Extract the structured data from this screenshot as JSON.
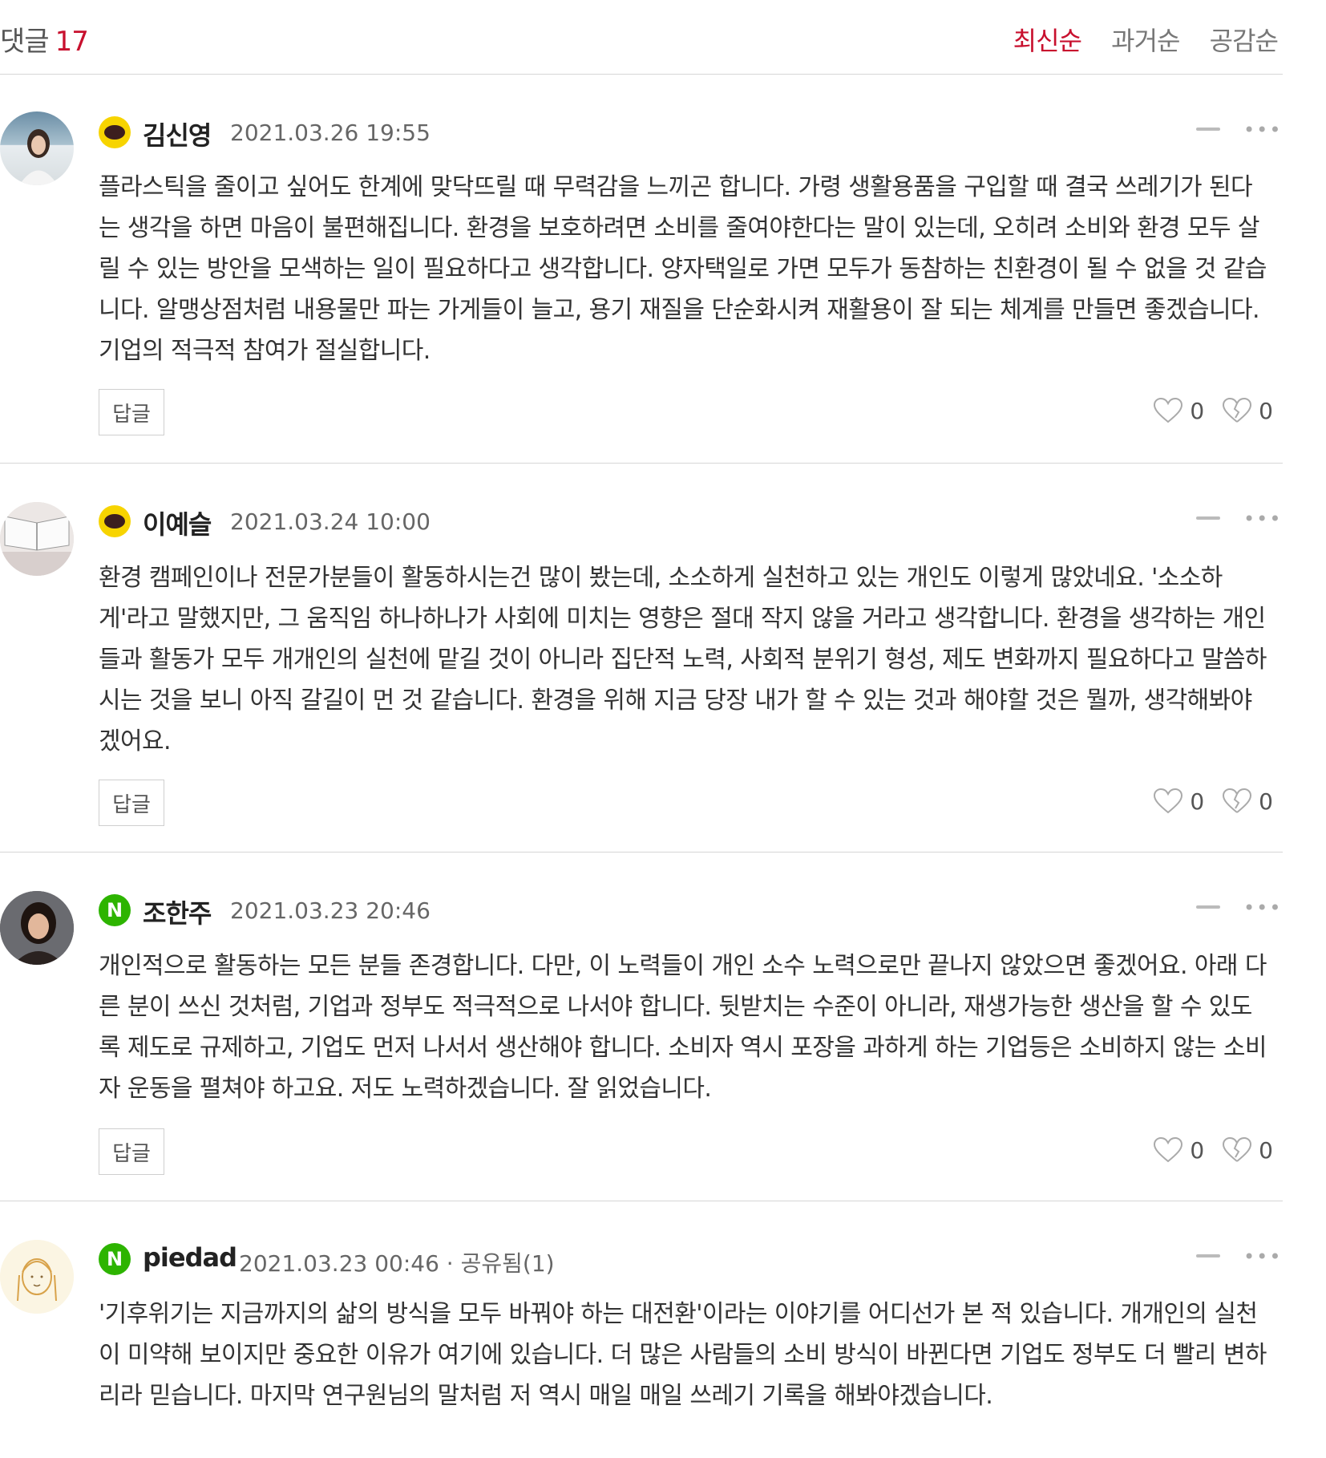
{
  "header": {
    "title": "댓글",
    "count": "17",
    "sort_options": [
      "최신순",
      "과거순",
      "공감순"
    ],
    "active_sort": "최신순"
  },
  "comments": [
    {
      "author": "김신영",
      "login": "kakao",
      "date": "2021.03.26 19:55",
      "text": "플라스틱을 줄이고 싶어도 한계에 맞닥뜨릴 때 무력감을 느끼곤 합니다. 가령 생활용품을 구입할 때 결국 쓰레기가 된다는 생각을 하면 마음이 불편해집니다. 환경을 보호하려면 소비를 줄여야한다는 말이 있는데, 오히려 소비와 환경 모두 살릴 수 있는 방안을 모색하는 일이 필요하다고 생각합니다. 양자택일로 가면 모두가 동참하는 친환경이 될 수 없을 것 같습니다. 알맹상점처럼 내용물만 파는 가게들이 늘고, 용기 재질을 단순화시켜 재활용이 잘 되는 체계를 만들면 좋겠습니다. 기업의 적극적 참여가 절실합니다.",
      "reply_label": "답글",
      "likes": "0",
      "dislikes": "0"
    },
    {
      "author": "이예슬",
      "login": "kakao",
      "date": "2021.03.24 10:00",
      "text": "환경 캠페인이나 전문가분들이 활동하시는건 많이 봤는데, 소소하게 실천하고 있는 개인도 이렇게 많았네요. '소소하게'라고 말했지만, 그 움직임 하나하나가 사회에 미치는 영향은 절대 작지 않을 거라고 생각합니다. 환경을 생각하는 개인들과 활동가 모두 개개인의 실천에 맡길 것이 아니라 집단적 노력, 사회적 분위기 형성, 제도 변화까지 필요하다고 말씀하시는 것을 보니 아직 갈길이 먼 것 같습니다. 환경을 위해 지금 당장 내가 할 수 있는 것과 해야할 것은 뭘까, 생각해봐야겠어요.",
      "reply_label": "답글",
      "likes": "0",
      "dislikes": "0"
    },
    {
      "author": "조한주",
      "login": "naver",
      "date": "2021.03.23 20:46",
      "text": "개인적으로 활동하는 모든 분들 존경합니다. 다만, 이 노력들이 개인 소수 노력으로만 끝나지 않았으면 좋겠어요. 아래 다른 분이 쓰신 것처럼, 기업과 정부도 적극적으로 나서야 합니다. 뒷받치는 수준이 아니라, 재생가능한 생산을 할 수 있도록 제도로 규제하고, 기업도 먼저 나서서 생산해야 합니다. 소비자 역시 포장을 과하게 하는 기업등은 소비하지 않는 소비자 운동을 펼쳐야 하고요. 저도 노력하겠습니다. 잘 읽었습니다.",
      "reply_label": "답글",
      "likes": "0",
      "dislikes": "0"
    },
    {
      "author": "piedad",
      "login": "naver",
      "date": "2021.03.23 00:46 · 공유됨(1)",
      "text": "'기후위기는 지금까지의 삶의 방식을 모두 바꿔야 하는 대전환'이라는 이야기를 어디선가 본 적 있습니다. 개개인의 실천이 미약해 보이지만 중요한 이유가 여기에 있습니다. 더 많은 사람들의 소비 방식이 바뀐다면 기업도 정부도 더 빨리 변하리라 믿습니다. 마지막 연구원님의 말처럼 저 역시 매일 매일 쓰레기 기록을 해봐야겠습니다."
    }
  ],
  "badges": {
    "naver": "N"
  },
  "colors": {
    "accent": "#c8102e",
    "kakao": "#f7d400",
    "naver": "#2db400"
  }
}
